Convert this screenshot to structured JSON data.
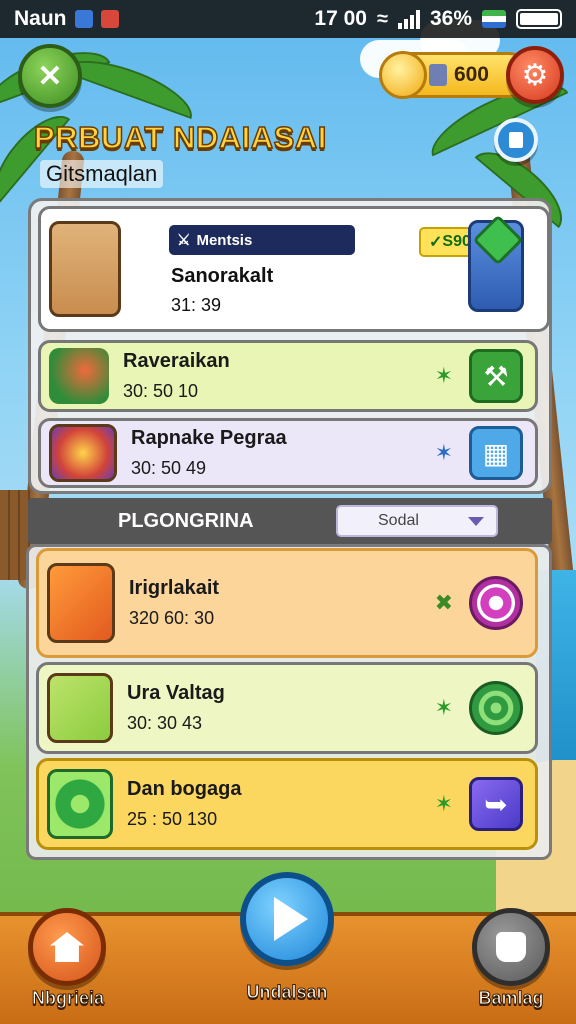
{
  "status_bar": {
    "carrier": "Naun",
    "time": "17 00",
    "battery_percent": "36%"
  },
  "header": {
    "coins": "600",
    "title": "PRBUAT NDAIASAI",
    "subtitle": "Gitsmaqlan"
  },
  "featured": {
    "band_label": "Mentsis",
    "price": "S900",
    "name": "Sanorakalt",
    "stats": "31: 39"
  },
  "top_items": [
    {
      "name": "Raveraikan",
      "stats": "30: 50 10"
    },
    {
      "name": "Rapnake Pegraa",
      "stats": "30: 50 49"
    }
  ],
  "section": {
    "title": "PLGONGRINA",
    "sort_value": "Sodal"
  },
  "list_items": [
    {
      "name": "Irigrlakait",
      "stats": "320 60: 30"
    },
    {
      "name": "Ura Valtag",
      "stats": "30: 30 43"
    },
    {
      "name": "Dan bogaga",
      "stats": "25 : 50 130"
    }
  ],
  "nav": {
    "home_label": "Nbgrieia",
    "play_label": "Undalsan",
    "bag_label": "Bamlag"
  },
  "colors": {
    "title_gold": "#ffd23e",
    "nav_orange": "#e8922f",
    "featured_band": "#1d2a5c"
  }
}
